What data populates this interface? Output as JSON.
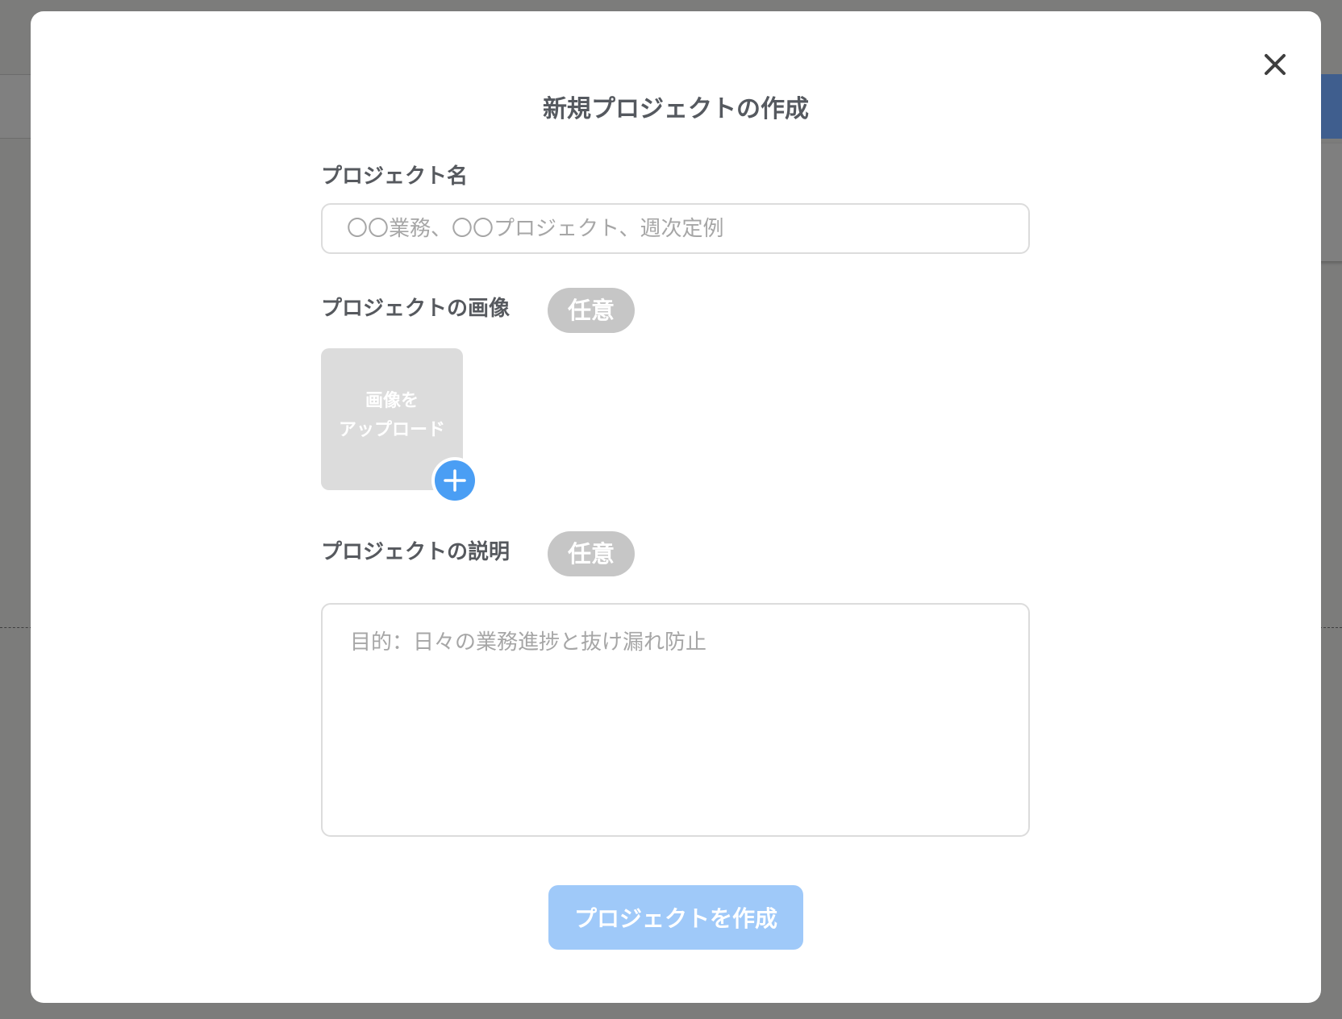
{
  "modal": {
    "title": "新規プロジェクトの作成",
    "close_icon": "close-icon"
  },
  "form": {
    "name": {
      "label": "プロジェクト名",
      "placeholder": "〇〇業務、〇〇プロジェクト、週次定例",
      "value": ""
    },
    "image": {
      "label": "プロジェクトの画像",
      "badge": "任意",
      "upload_text": "画像を\nアップロード",
      "add_icon": "plus-icon"
    },
    "description": {
      "label": "プロジェクトの説明",
      "badge": "任意",
      "placeholder": "目的：日々の業務進捗と抜け漏れ防止",
      "value": ""
    },
    "submit_label": "プロジェクトを作成"
  },
  "colors": {
    "overlay": "#7c7c7b",
    "modal_bg": "#ffffff",
    "text": "#56595e",
    "badge_bg": "#c6c6c6",
    "upload_tile_bg": "#dcdcdc",
    "plus_button": "#4a9ef4",
    "submit_button_disabled": "#9fc9f9"
  }
}
